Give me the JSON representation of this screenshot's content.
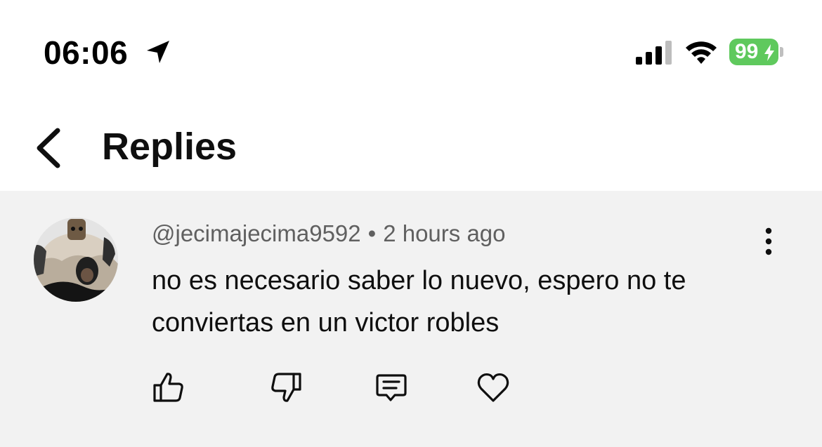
{
  "status_bar": {
    "time": "06:06",
    "battery_level": "99",
    "battery_color": "#5fc95d",
    "icons": [
      "location-arrow-icon",
      "cellular-signal-icon",
      "wifi-icon",
      "battery-icon",
      "charging-bolt-icon"
    ]
  },
  "header": {
    "title": "Replies",
    "back_icon": "chevron-left-icon"
  },
  "comment": {
    "author": "@jecimajecima9592",
    "separator": "•",
    "time_ago": "2 hours ago",
    "text": "no es necesario saber lo nuevo, espero no te conviertas en un victor robles",
    "more_icon": "vertical-ellipsis-icon",
    "actions": [
      "thumbs-up-icon",
      "thumbs-down-icon",
      "reply-comment-icon",
      "heart-icon"
    ]
  },
  "colors": {
    "panel_background": "#f2f2f2",
    "meta_text": "#606060",
    "primary_text": "#0f0f0f"
  }
}
